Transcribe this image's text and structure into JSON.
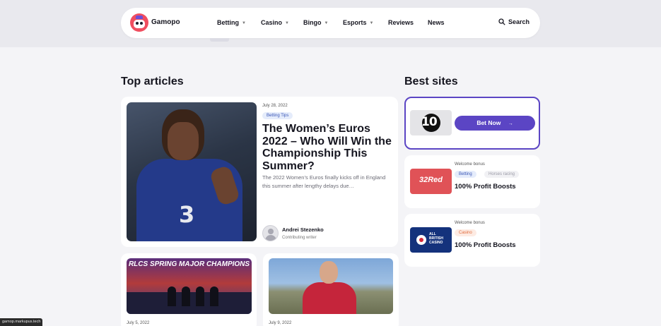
{
  "header": {
    "brand": "Gamopo",
    "nav": [
      {
        "label": "Betting",
        "dropdown": true
      },
      {
        "label": "Casino",
        "dropdown": true
      },
      {
        "label": "Bingo",
        "dropdown": true
      },
      {
        "label": "Esports",
        "dropdown": true
      },
      {
        "label": "Reviews",
        "dropdown": false
      },
      {
        "label": "News",
        "dropdown": false
      }
    ],
    "search_label": "Search"
  },
  "top_articles": {
    "title": "Top articles",
    "featured": {
      "date": "July 28, 2022",
      "tag": "Betting Tips",
      "title": "The Women’s Euros 2022 – Who Will Win the Championship This Summer?",
      "excerpt": "The 2022 Women’s Euros finally kicks off in England this summer after lengthy delays due…",
      "author": "Andrei Stezenko",
      "role": "Contributing writer",
      "image": {
        "jersey_number": "3"
      }
    },
    "cards": [
      {
        "date": "July 5, 2022",
        "image_text": "RLCS SPRING MAJOR CHAMPIONS"
      },
      {
        "date": "July 9, 2022"
      }
    ]
  },
  "best_sites": {
    "title": "Best sites",
    "items": [
      {
        "logo_text": "10",
        "button": "Bet Now",
        "button_icon": "arrow-right-icon"
      },
      {
        "logo_text": "32Red",
        "welcome": "Welcome bonus",
        "tags": [
          "Betting",
          "Horses racing"
        ],
        "offer": "100% Profit Boosts"
      },
      {
        "logo_text": "ALL BRITISH CASINO",
        "welcome": "Welcome bonus",
        "tags": [
          "Casino"
        ],
        "offer": "100% Profit Boosts"
      }
    ]
  },
  "status_bar": {
    "url": "gamop.markupus.tech"
  },
  "colors": {
    "accent": "#5b45c4",
    "background": "#f4f4f7",
    "card": "#ffffff",
    "red_brand": "#e05257",
    "abc_navy": "#14327c"
  }
}
